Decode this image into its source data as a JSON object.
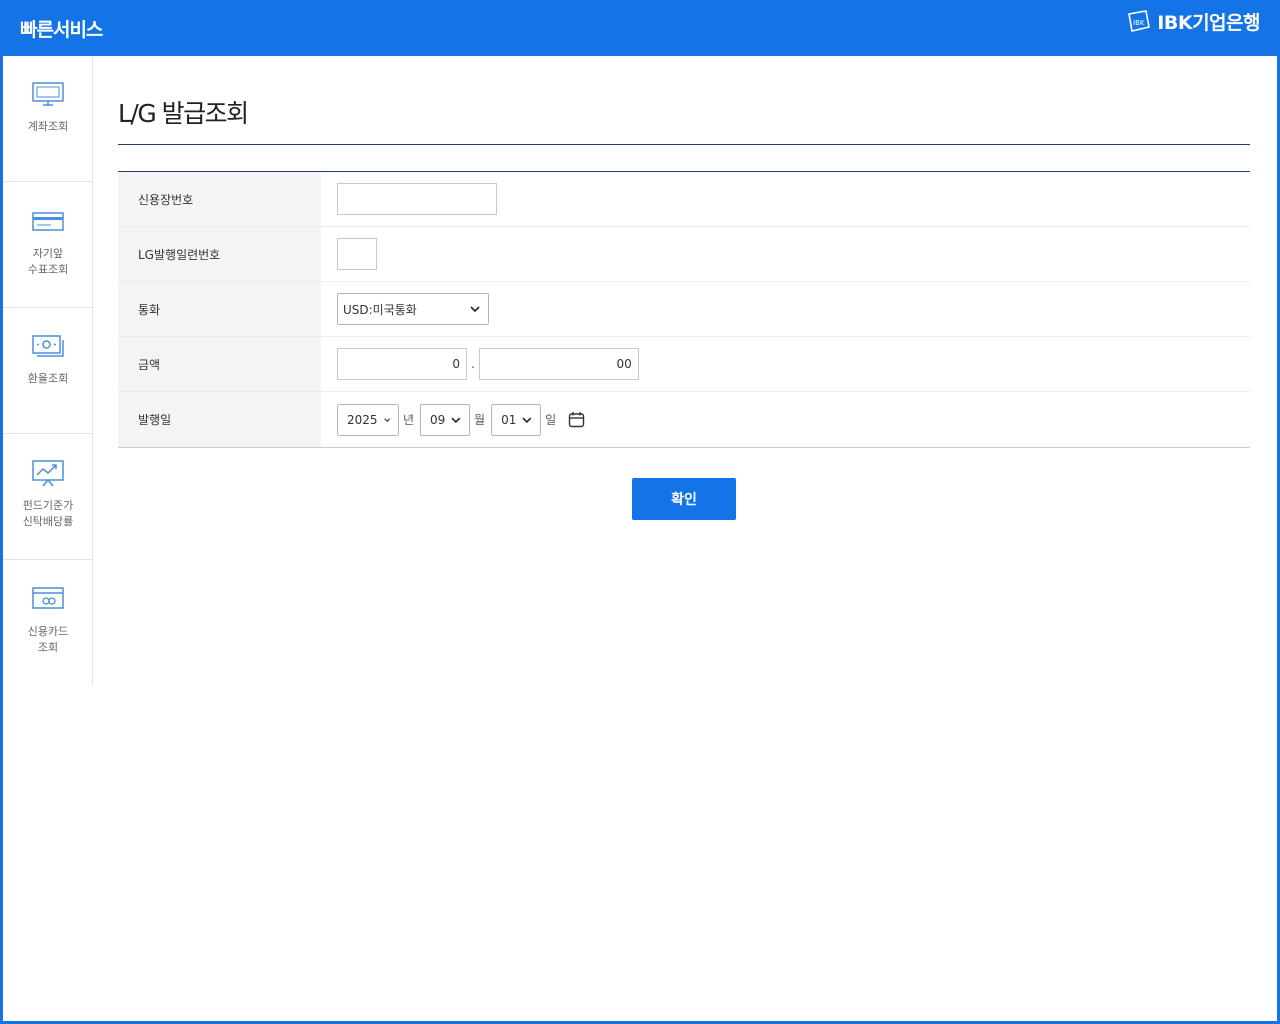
{
  "header": {
    "title": "빠른서비스",
    "logo_text": "IBK기업은행",
    "logo_mark_text": "IBK",
    "logo_icon": "ibk-logo-icon"
  },
  "sidebar": {
    "items": [
      {
        "label": "계좌조회",
        "icon": "monitor-icon"
      },
      {
        "label": "자기앞\n수표조회",
        "icon": "check-icon"
      },
      {
        "label": "환율조회",
        "icon": "banknote-icon"
      },
      {
        "label": "펀드기준가\n신탁배당률",
        "icon": "chart-icon"
      },
      {
        "label": "신용카드\n조회",
        "icon": "card-icon"
      }
    ]
  },
  "main": {
    "title": "L/G 발급조회",
    "fields": {
      "lc_number": {
        "label": "신용장번호",
        "value": ""
      },
      "lg_serial": {
        "label": "LG발행일련번호",
        "value": ""
      },
      "currency": {
        "label": "통화",
        "value": "USD:미국통화"
      },
      "amount": {
        "label": "금액",
        "integer": "0",
        "separator": ".",
        "decimal": "00"
      },
      "issue_date": {
        "label": "발행일",
        "year": "2025",
        "year_unit": "년",
        "month": "09",
        "month_unit": "월",
        "day": "01",
        "day_unit": "일"
      }
    },
    "confirm_label": "확인"
  },
  "colors": {
    "brand": "#1473e6",
    "rule": "#1f3e73",
    "label_bg": "#f4f4f4"
  }
}
